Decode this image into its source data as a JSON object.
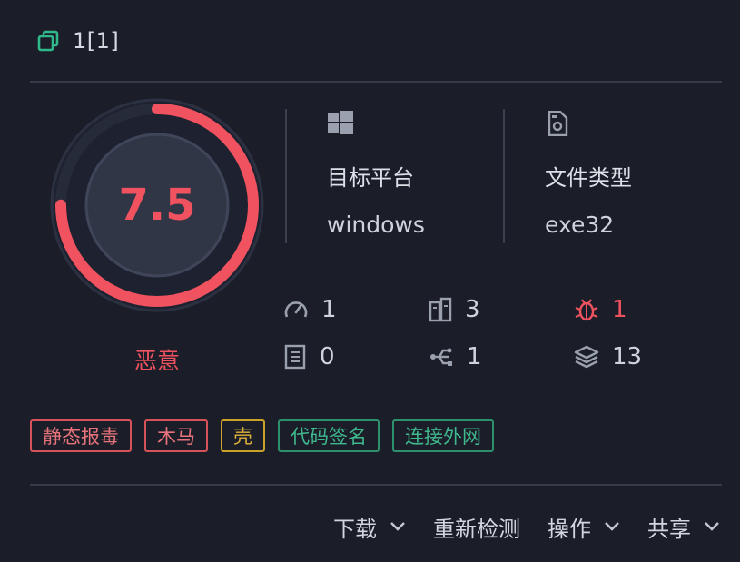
{
  "header": {
    "title": "1[1]",
    "icon": "copy-icon",
    "accent": "#2fb98a"
  },
  "score": {
    "value": "7.5",
    "max": 10,
    "verdict": "恶意",
    "color": "#f0525f"
  },
  "info": {
    "platform": {
      "label": "目标平台",
      "value": "windows",
      "icon": "windows-icon"
    },
    "filetype": {
      "label": "文件类型",
      "value": "exe32",
      "icon": "file-icon"
    }
  },
  "stats": [
    {
      "icon": "gauge-icon",
      "value": "1"
    },
    {
      "icon": "module-icon",
      "value": "3"
    },
    {
      "icon": "bug-icon",
      "value": "1",
      "danger": true
    },
    {
      "icon": "document-list-icon",
      "value": "0"
    },
    {
      "icon": "network-icon",
      "value": "1"
    },
    {
      "icon": "layers-icon",
      "value": "13"
    }
  ],
  "tags": [
    {
      "label": "静态报毒",
      "color": "red"
    },
    {
      "label": "木马",
      "color": "red"
    },
    {
      "label": "壳",
      "color": "yellow"
    },
    {
      "label": "代码签名",
      "color": "green"
    },
    {
      "label": "连接外网",
      "color": "green"
    }
  ],
  "actions": {
    "download": "下载",
    "recheck": "重新检测",
    "operate": "操作",
    "share": "共享"
  }
}
